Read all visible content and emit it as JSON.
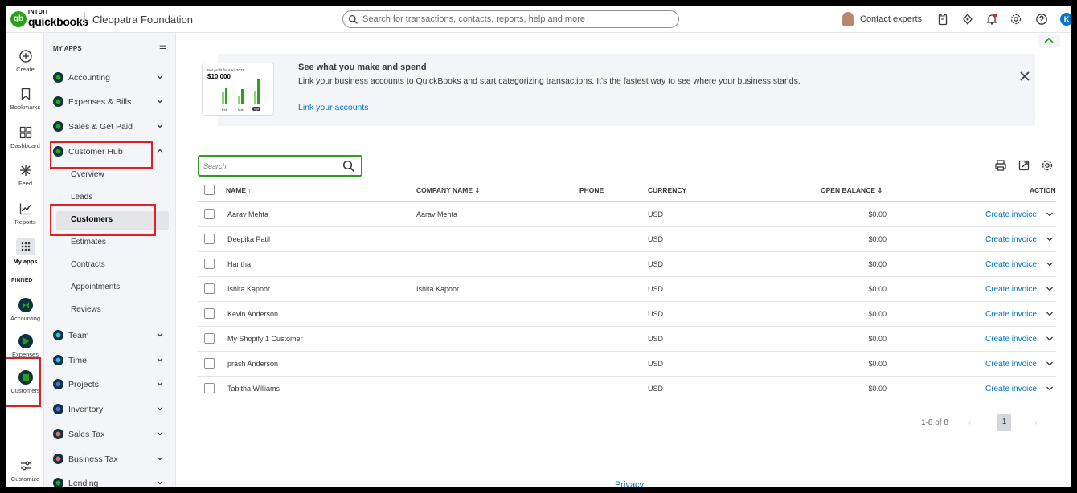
{
  "brand": {
    "intuit": "INTUIT",
    "product": "quickbooks",
    "logo_letters": "qb",
    "color": "#2ca01c"
  },
  "company_name": "Cleopatra Foundation",
  "top_search": {
    "placeholder": "Search for transactions, contacts, reports, help and more"
  },
  "contact_experts": "Contact experts",
  "user_initial": "K",
  "rail": {
    "items": [
      {
        "label": "Create",
        "icon": "plus-circle-icon"
      },
      {
        "label": "Bookmarks",
        "icon": "bookmark-icon"
      },
      {
        "label": "Dashboard",
        "icon": "dashboard-grid-icon"
      },
      {
        "label": "Feed",
        "icon": "sparkle-icon"
      },
      {
        "label": "Reports",
        "icon": "line-chart-icon"
      },
      {
        "label": "My apps",
        "icon": "apps-grid-icon"
      }
    ],
    "pinned_label": "PINNED",
    "pinned": [
      {
        "label": "Accounting",
        "icon": "accounting-icon"
      },
      {
        "label": "Expenses",
        "icon": "expenses-icon"
      },
      {
        "label": "Customers",
        "icon": "customers-icon"
      }
    ],
    "customize": "Customize"
  },
  "menu": {
    "heading": "MY APPS",
    "apps_before": [
      {
        "label": "Accounting",
        "color": "#2ca01c"
      },
      {
        "label": "Expenses & Bills",
        "color": "#2ca01c"
      },
      {
        "label": "Sales & Get Paid",
        "color": "#2ca01c"
      }
    ],
    "hub": {
      "label": "Customer Hub",
      "color": "#2ca01c"
    },
    "sub_items": [
      "Overview",
      "Leads",
      "Customers",
      "Estimates",
      "Contracts",
      "Appointments",
      "Reviews"
    ],
    "active_sub": "Customers",
    "apps_after": [
      {
        "label": "Team",
        "color": "#3db8e8"
      },
      {
        "label": "Time",
        "color": "#3db8e8"
      },
      {
        "label": "Projects",
        "color": "#5b6bd6"
      },
      {
        "label": "Inventory",
        "color": "#5b6bd6"
      },
      {
        "label": "Sales Tax",
        "color": "#e36a6a"
      },
      {
        "label": "Business Tax",
        "color": "#e36a6a"
      },
      {
        "label": "Lending",
        "color": "#2ca01c"
      }
    ]
  },
  "banner": {
    "card_title": "Net profit for April 2021",
    "card_value": "$10,000",
    "card_months": [
      "Feb",
      "Mar",
      "Apr"
    ],
    "title": "See what you make and spend",
    "description": "Link your business accounts to QuickBooks and start categorizing transactions. It's the fastest way to see where your business stands.",
    "link": "Link your accounts"
  },
  "table": {
    "search_placeholder": "Search",
    "columns": {
      "name": "NAME",
      "company": "COMPANY NAME",
      "phone": "PHONE",
      "currency": "CURRENCY",
      "balance": "OPEN BALANCE",
      "action": "ACTION"
    },
    "rows": [
      {
        "name": "Aarav Mehta",
        "company": "Aarav Mehta",
        "phone": "",
        "currency": "USD",
        "balance": "$0.00",
        "action": "Create invoice"
      },
      {
        "name": "Deepika Patil",
        "company": "",
        "phone": "",
        "currency": "USD",
        "balance": "$0.00",
        "action": "Create invoice"
      },
      {
        "name": "Haritha",
        "company": "",
        "phone": "",
        "currency": "USD",
        "balance": "$0.00",
        "action": "Create invoice"
      },
      {
        "name": "Ishita Kapoor",
        "company": "Ishita Kapoor",
        "phone": "",
        "currency": "USD",
        "balance": "$0.00",
        "action": "Create invoice"
      },
      {
        "name": "Kevin Anderson",
        "company": "",
        "phone": "",
        "currency": "USD",
        "balance": "$0.00",
        "action": "Create invoice"
      },
      {
        "name": "My Shopify 1 Customer",
        "company": "",
        "phone": "",
        "currency": "USD",
        "balance": "$0.00",
        "action": "Create invoice"
      },
      {
        "name": "prash Anderson",
        "company": "",
        "phone": "",
        "currency": "USD",
        "balance": "$0.00",
        "action": "Create invoice"
      },
      {
        "name": "Tabitha Williams",
        "company": "",
        "phone": "",
        "currency": "USD",
        "balance": "$0.00",
        "action": "Create invoice"
      }
    ]
  },
  "pagination": {
    "range": "1-8 of 8",
    "current_page": "1",
    "prev": "‹",
    "next": "›"
  },
  "footer": {
    "privacy": "Privacy"
  },
  "colors": {
    "link": "#0077c5",
    "highlight": "#e02020",
    "green": "#2ca01c"
  }
}
